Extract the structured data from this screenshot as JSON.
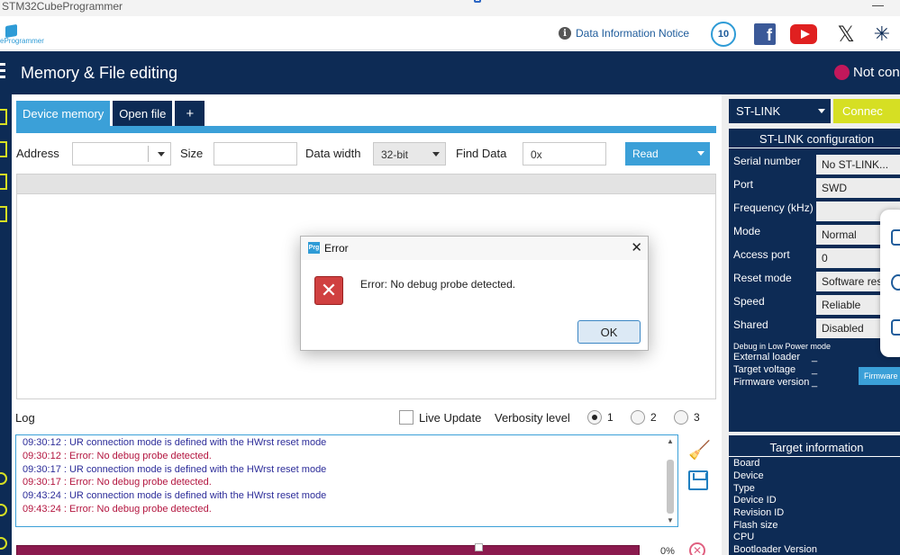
{
  "window": {
    "title": "STM32CubeProgrammer"
  },
  "brand": {
    "logo_label": "eProgrammer",
    "notice_label": "Data Information Notice",
    "badge_text": "10"
  },
  "header": {
    "title": "Memory & File editing",
    "status": "Not con"
  },
  "tabs": [
    {
      "label": "Device memory"
    },
    {
      "label": "Open file"
    },
    {
      "label": "+"
    }
  ],
  "fields": {
    "address_label": "Address",
    "address_value": "",
    "size_label": "Size",
    "size_value": "",
    "data_width_label": "Data width",
    "data_width_value": "32-bit",
    "find_data_label": "Find Data",
    "find_data_value": "0x",
    "read_label": "Read"
  },
  "log": {
    "label": "Log",
    "live_update_label": "Live Update",
    "verbosity_label": "Verbosity level",
    "levels": [
      "1",
      "2",
      "3"
    ],
    "selected_level": "1",
    "lines": [
      {
        "type": "info",
        "text": "09:30:12 : UR connection mode is defined with the HWrst reset mode"
      },
      {
        "type": "err",
        "text": "09:30:12 : Error: No debug probe detected."
      },
      {
        "type": "info",
        "text": "09:30:17 : UR connection mode is defined with the HWrst reset mode"
      },
      {
        "type": "err",
        "text": "09:30:17 : Error: No debug probe detected."
      },
      {
        "type": "info",
        "text": "09:43:24 : UR connection mode is defined with the HWrst reset mode"
      },
      {
        "type": "err",
        "text": "09:43:24 : Error: No debug probe detected."
      }
    ],
    "progress_text": "0%"
  },
  "right_panel": {
    "interface": "ST-LINK",
    "connect_label": "Connec",
    "config_title": "ST-LINK configuration",
    "config_rows": [
      {
        "label": "Serial number",
        "value": "No ST-LINK..."
      },
      {
        "label": "Port",
        "value": "SWD"
      },
      {
        "label": "Frequency (kHz)",
        "value": ""
      },
      {
        "label": "Mode",
        "value": "Normal"
      },
      {
        "label": "Access port",
        "value": "0"
      },
      {
        "label": "Reset mode",
        "value": "Software res"
      },
      {
        "label": "Speed",
        "value": "Reliable"
      },
      {
        "label": "Shared",
        "value": "Disabled"
      }
    ],
    "low_power_label": "Debug in Low Power mode",
    "external_loader_label": "External loader",
    "target_voltage_label": "Target voltage",
    "firmware_version_label": "Firmware version",
    "firmware_button": "Firmware",
    "underscore": "_",
    "target_title": "Target information",
    "target_rows": [
      "Board",
      "Device",
      "Type",
      "Device ID",
      "Revision ID",
      "Flash size",
      "CPU",
      "Bootloader Version"
    ]
  },
  "dialog": {
    "title": "Error",
    "app_icon_text": "Prg",
    "message": "Error: No debug probe detected.",
    "ok_label": "OK"
  },
  "colors": {
    "navy": "#0d2b55",
    "accent_blue": "#3ba0d8",
    "connect_yellow": "#d6df23",
    "error_red": "#b3153f"
  }
}
